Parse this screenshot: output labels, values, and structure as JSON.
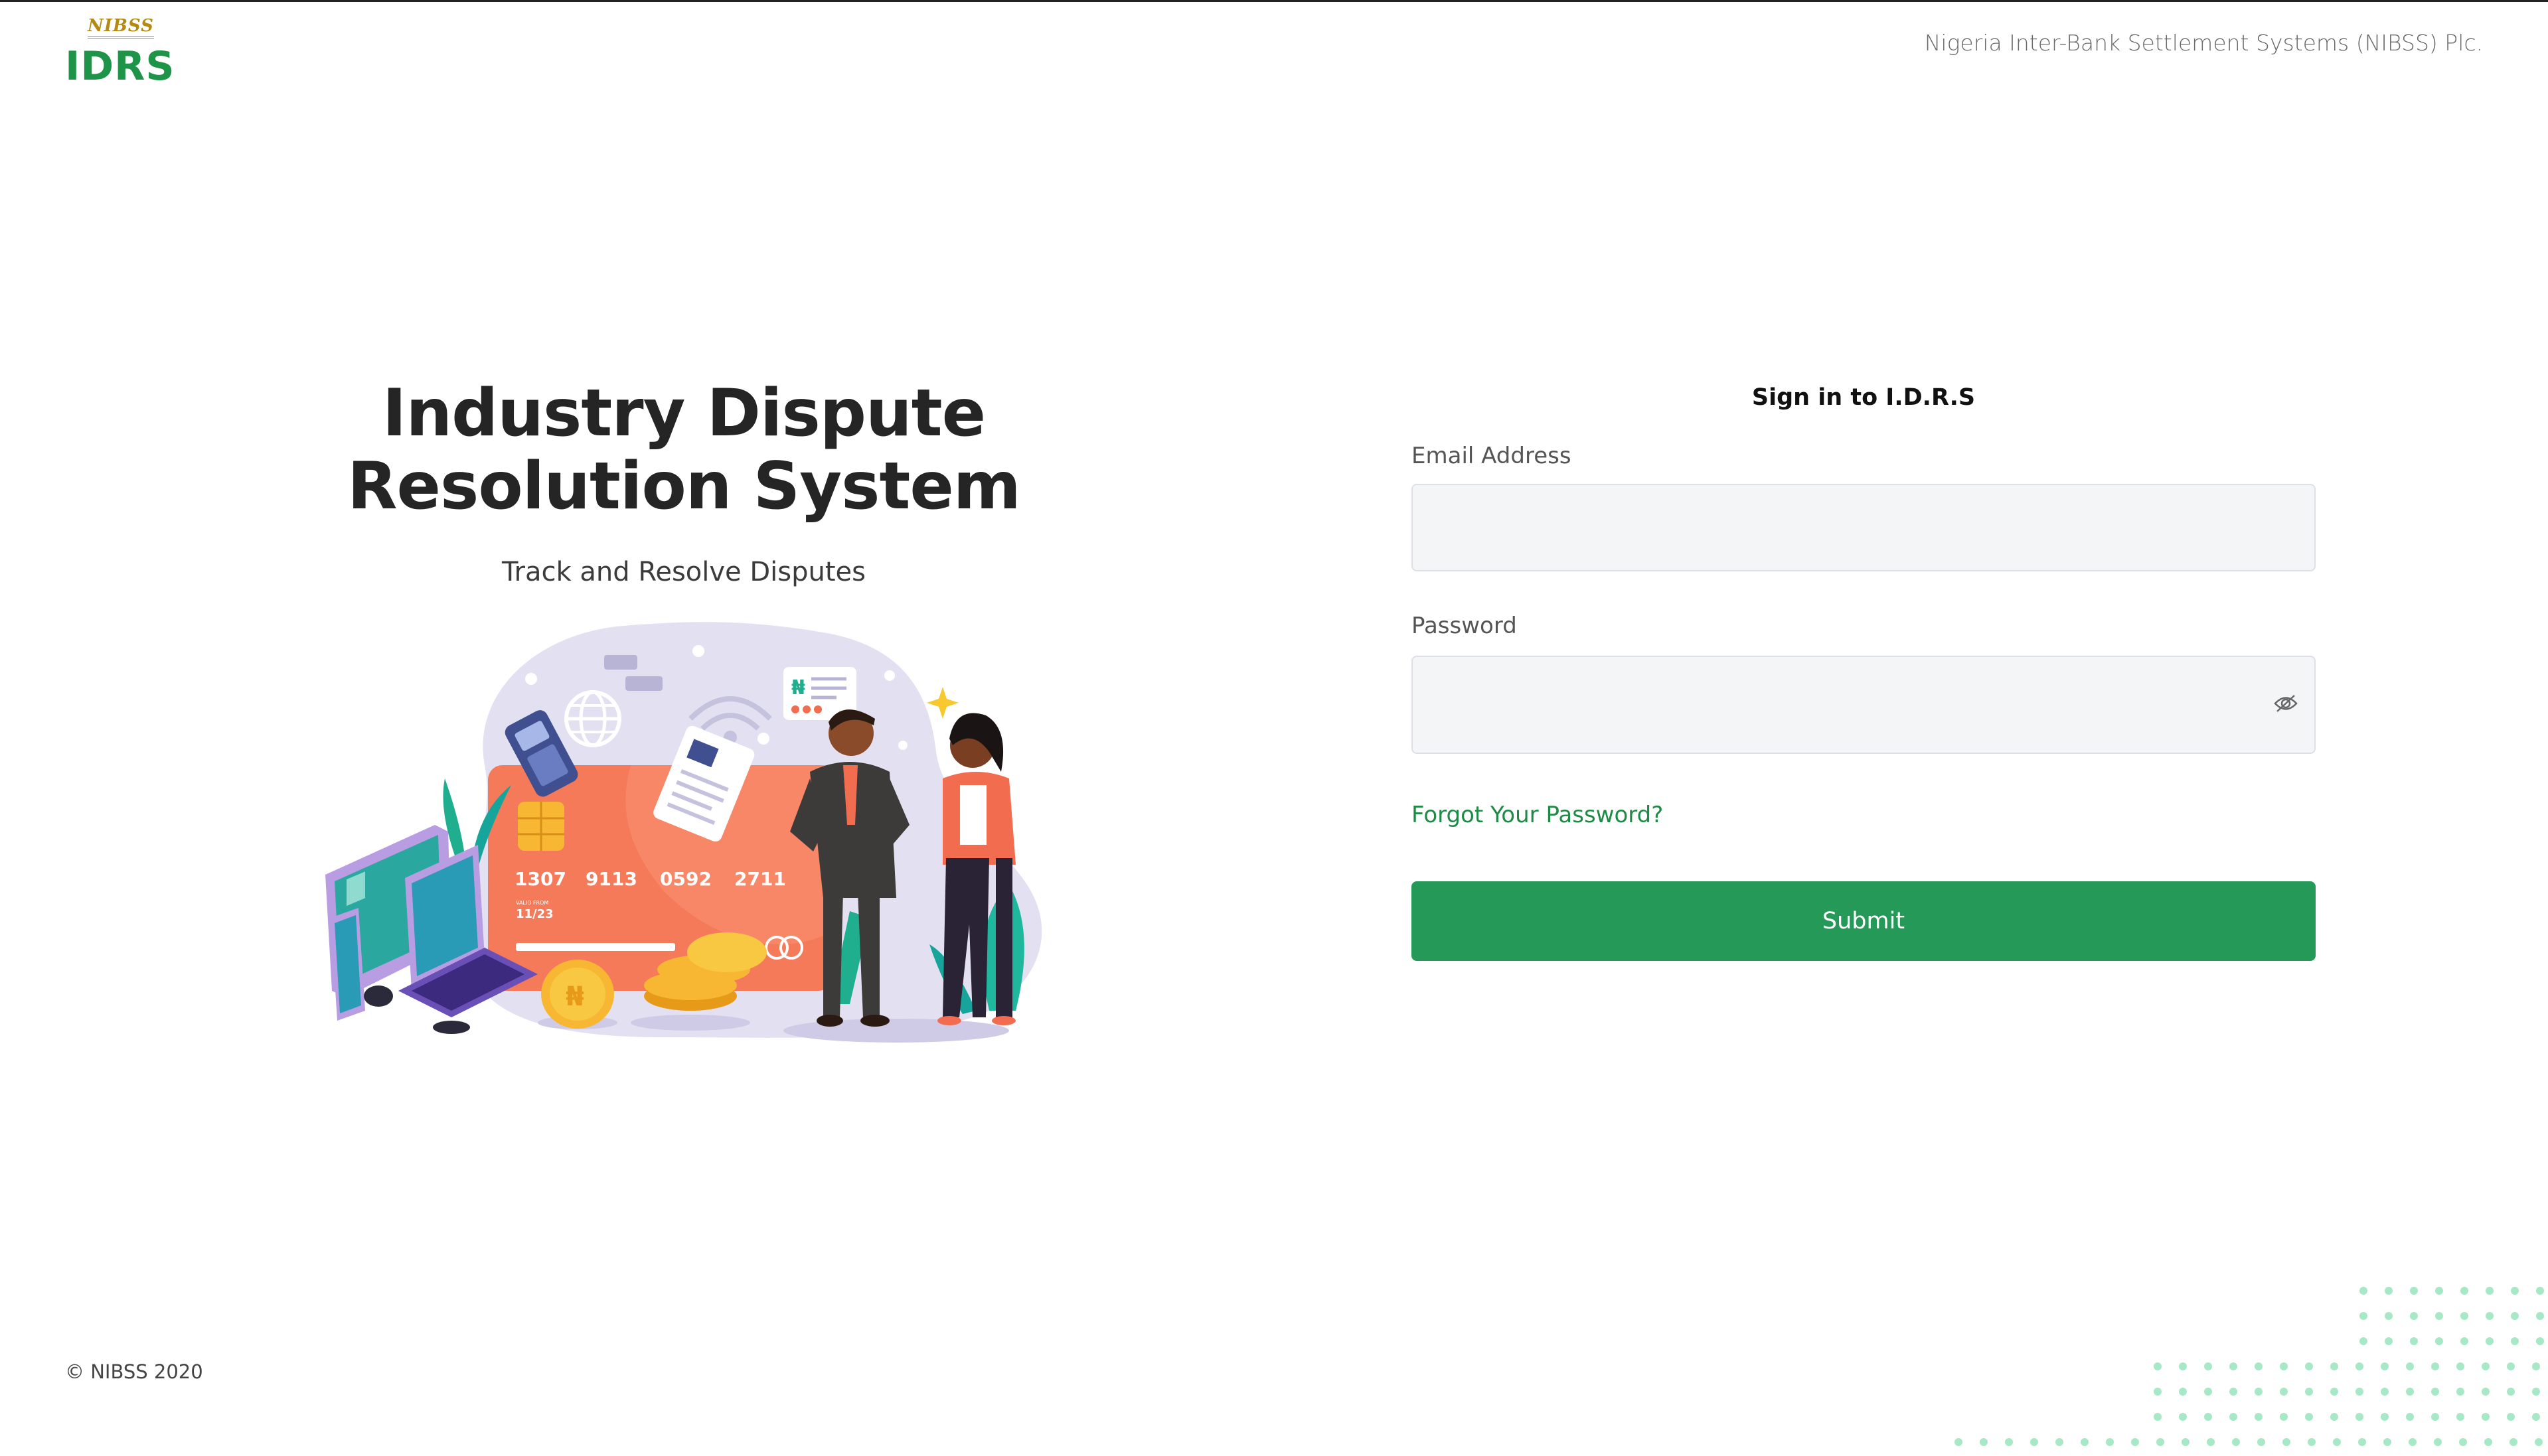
{
  "header": {
    "logo_mark": "NIBSS",
    "logo_text": "IDRS",
    "org_name": "Nigeria Inter-Bank Settlement Systems (NIBSS) Plc."
  },
  "hero": {
    "title_line1": "Industry Dispute",
    "title_line2": "Resolution System",
    "subtitle": "Track and Resolve Disputes",
    "card": {
      "number_groups": [
        "1307",
        "9113",
        "0592",
        "2711"
      ],
      "valid_label": "VALID FROM",
      "expiry": "11/23"
    },
    "currency_symbol": "₦"
  },
  "form": {
    "title": "Sign in to I.D.R.S",
    "email_label": "Email Address",
    "email_value": "",
    "password_label": "Password",
    "password_value": "",
    "forgot_label": "Forgot Your Password?",
    "submit_label": "Submit"
  },
  "footer": {
    "copyright": "© NIBSS 2020"
  },
  "colors": {
    "brand_green": "#1e9448",
    "button_green": "#259a58",
    "logo_gold": "#b58a12",
    "input_bg": "#f4f5f6",
    "dot_green": "#a7e8c7"
  },
  "icons": {
    "password_toggle": "eye-slash-icon"
  }
}
